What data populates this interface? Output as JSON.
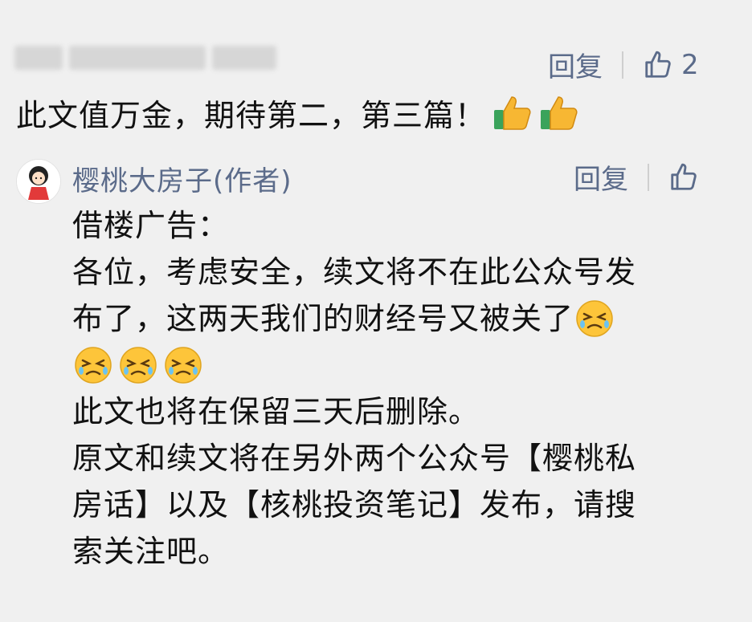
{
  "top_comment": {
    "text": "此文值万金，期待第二，第三篇！",
    "reply_label": "回复",
    "like_count": "2",
    "emoji": [
      "thumbs-up",
      "thumbs-up"
    ]
  },
  "author_reply": {
    "author": "樱桃大房子(作者)",
    "reply_label": "回复",
    "lines": [
      "借楼广告：",
      "各位，考虑安全，续文将不在此公众号发",
      "布了，这两天我们的财经号又被关了",
      "",
      "此文也将在保留三天后删除。",
      "原文和续文将在另外两个公众号【樱桃私",
      "房话】以及【核桃投资笔记】发布，请搜",
      "索关注吧。"
    ],
    "emoji": [
      "crying-face",
      "crying-face",
      "crying-face",
      "crying-face"
    ]
  },
  "colors": {
    "link": "#5b6b8a",
    "background": "#f0f0f0",
    "text": "#111111"
  }
}
